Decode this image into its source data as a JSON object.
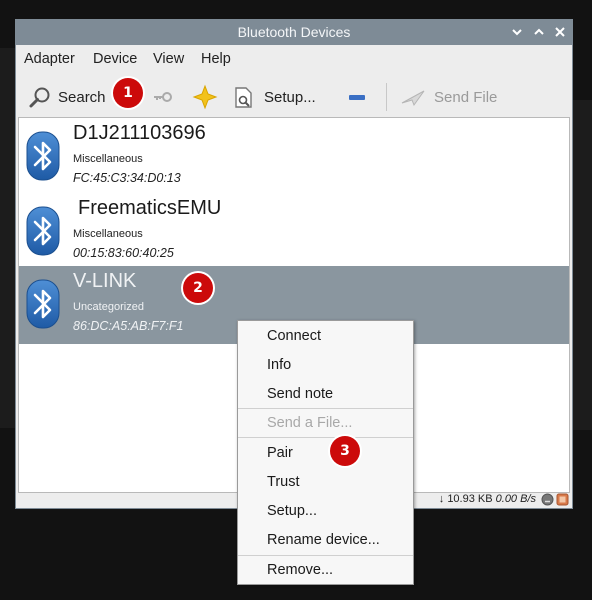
{
  "window": {
    "title": "Bluetooth Devices"
  },
  "menubar": [
    "Adapter",
    "Device",
    "View",
    "Help"
  ],
  "toolbar": {
    "search_label": "Search",
    "setup_label": "Setup...",
    "send_file_label": "Send File"
  },
  "devices": [
    {
      "name": "D1J211103696",
      "class": "Miscellaneous",
      "address": "FC:45:C3:34:D0:13"
    },
    {
      "name": "FreematicsEMU",
      "class": "Miscellaneous",
      "address": "00:15:83:60:40:25"
    },
    {
      "name": "V-LINK",
      "class": "Uncategorized",
      "address": "86:DC:A5:AB:F7:F1"
    }
  ],
  "statusbar": {
    "transferred": "10.93 KB",
    "rate": "0.00 B/s"
  },
  "context_menu": {
    "connect": "Connect",
    "info": "Info",
    "send_note": "Send note",
    "send_file": "Send a File...",
    "pair": "Pair",
    "trust": "Trust",
    "setup": "Setup...",
    "rename": "Rename device...",
    "remove": "Remove..."
  },
  "badges": [
    "1",
    "2",
    "3"
  ],
  "colors": {
    "titlebar": "#7e8b96",
    "selection": "#8a969f",
    "badge": "#cc0a0a",
    "bluetooth": "#2a6bb3"
  }
}
